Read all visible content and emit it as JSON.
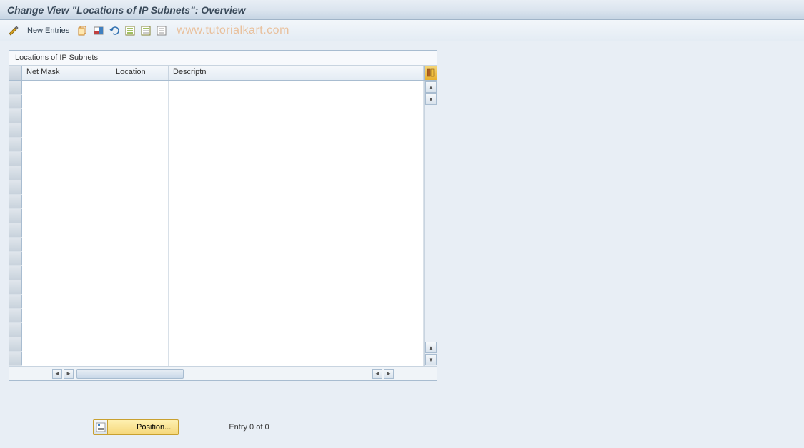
{
  "title": "Change View \"Locations of IP Subnets\": Overview",
  "toolbar": {
    "new_entries_label": "New Entries"
  },
  "watermark": "www.tutorialkart.com",
  "panel": {
    "title": "Locations of IP Subnets",
    "columns": {
      "netmask": "Net Mask",
      "location": "Location",
      "descriptn": "Descriptn"
    },
    "rows": [
      {
        "netmask": "",
        "location": "",
        "descriptn": ""
      },
      {
        "netmask": "",
        "location": "",
        "descriptn": ""
      },
      {
        "netmask": "",
        "location": "",
        "descriptn": ""
      },
      {
        "netmask": "",
        "location": "",
        "descriptn": ""
      },
      {
        "netmask": "",
        "location": "",
        "descriptn": ""
      },
      {
        "netmask": "",
        "location": "",
        "descriptn": ""
      },
      {
        "netmask": "",
        "location": "",
        "descriptn": ""
      },
      {
        "netmask": "",
        "location": "",
        "descriptn": ""
      },
      {
        "netmask": "",
        "location": "",
        "descriptn": ""
      },
      {
        "netmask": "",
        "location": "",
        "descriptn": ""
      },
      {
        "netmask": "",
        "location": "",
        "descriptn": ""
      },
      {
        "netmask": "",
        "location": "",
        "descriptn": ""
      },
      {
        "netmask": "",
        "location": "",
        "descriptn": ""
      },
      {
        "netmask": "",
        "location": "",
        "descriptn": ""
      },
      {
        "netmask": "",
        "location": "",
        "descriptn": ""
      },
      {
        "netmask": "",
        "location": "",
        "descriptn": ""
      },
      {
        "netmask": "",
        "location": "",
        "descriptn": ""
      },
      {
        "netmask": "",
        "location": "",
        "descriptn": ""
      },
      {
        "netmask": "",
        "location": "",
        "descriptn": ""
      },
      {
        "netmask": "",
        "location": "",
        "descriptn": ""
      }
    ]
  },
  "footer": {
    "position_label": "Position...",
    "entry_text": "Entry 0 of 0"
  }
}
